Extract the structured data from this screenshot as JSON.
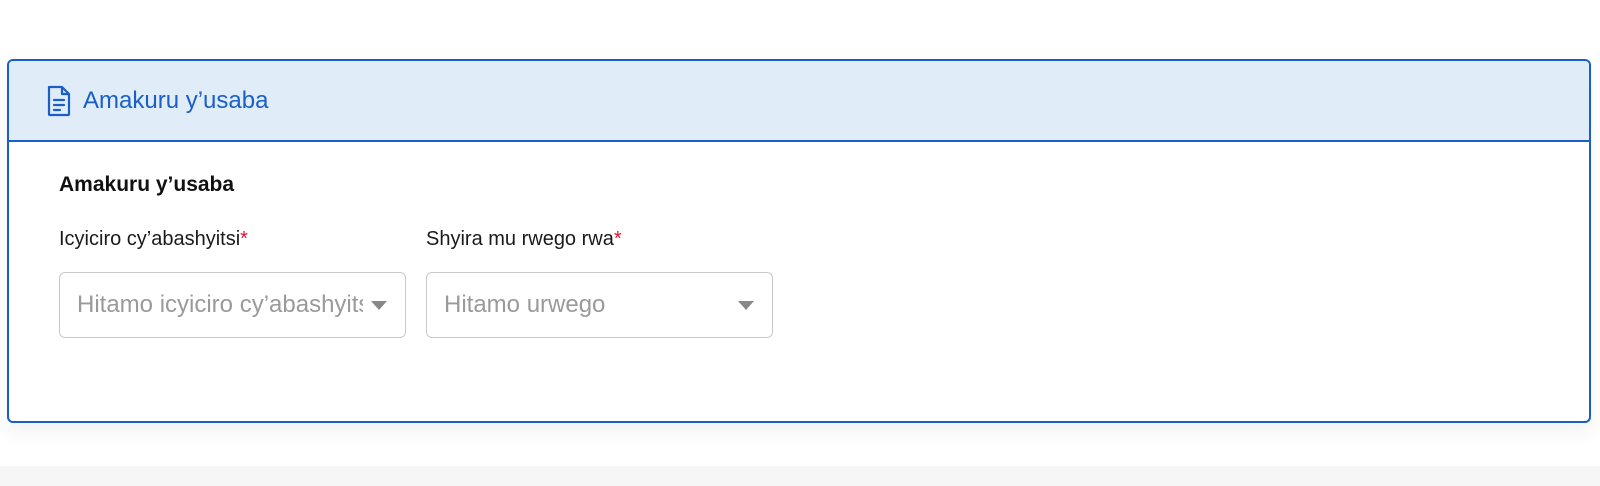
{
  "card": {
    "header_title": "Amakuru y’usaba",
    "header_icon": "document-icon",
    "accent_color": "#1a5fc7",
    "header_bg": "#e0edf8"
  },
  "section": {
    "title": "Amakuru y’usaba"
  },
  "fields": [
    {
      "label": "Icyiciro cy’abashyitsi",
      "required_mark": "*",
      "placeholder": "Hitamo icyiciro cy’abashyitsi"
    },
    {
      "label": "Shyira mu rwego rwa",
      "required_mark": "*",
      "placeholder": "Hitamo urwego"
    }
  ]
}
